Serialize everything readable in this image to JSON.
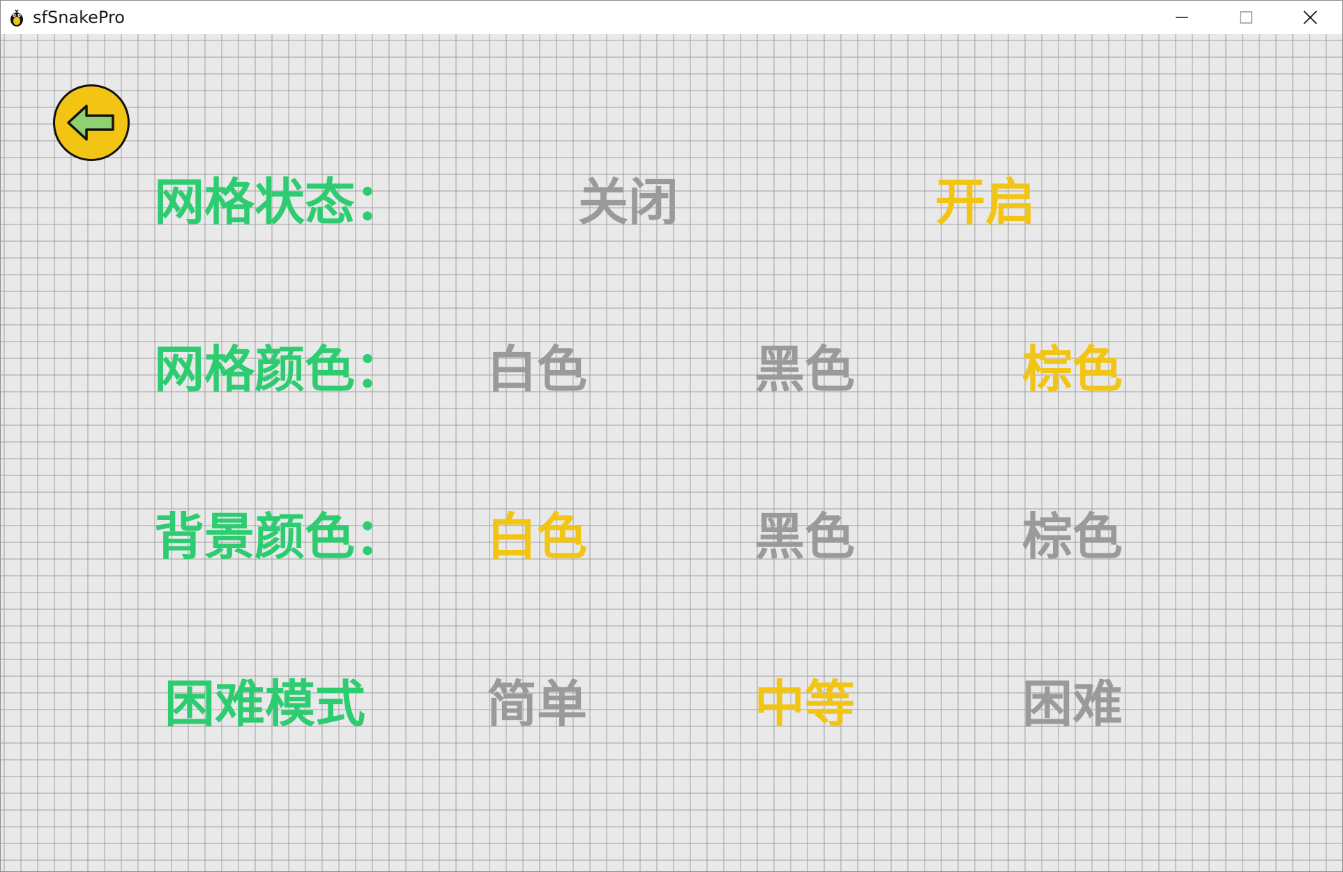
{
  "window": {
    "title": "sfSnakePro"
  },
  "colors": {
    "label": "#2ecc71",
    "selected": "#f2c414",
    "unselected": "#9a9a9a",
    "background": "#e9e9e9"
  },
  "settings": {
    "grid_state": {
      "label": "网格状态：",
      "options": [
        {
          "text": "关闭",
          "selected": false
        },
        {
          "text": "开启",
          "selected": true
        }
      ]
    },
    "grid_color": {
      "label": "网格颜色：",
      "options": [
        {
          "text": "白色",
          "selected": false
        },
        {
          "text": "黑色",
          "selected": false
        },
        {
          "text": "棕色",
          "selected": true
        }
      ]
    },
    "bg_color": {
      "label": "背景颜色：",
      "options": [
        {
          "text": "白色",
          "selected": true
        },
        {
          "text": "黑色",
          "selected": false
        },
        {
          "text": "棕色",
          "selected": false
        }
      ]
    },
    "difficulty": {
      "label": "困难模式",
      "options": [
        {
          "text": "简单",
          "selected": false
        },
        {
          "text": "中等",
          "selected": true
        },
        {
          "text": "困难",
          "selected": false
        }
      ]
    }
  }
}
